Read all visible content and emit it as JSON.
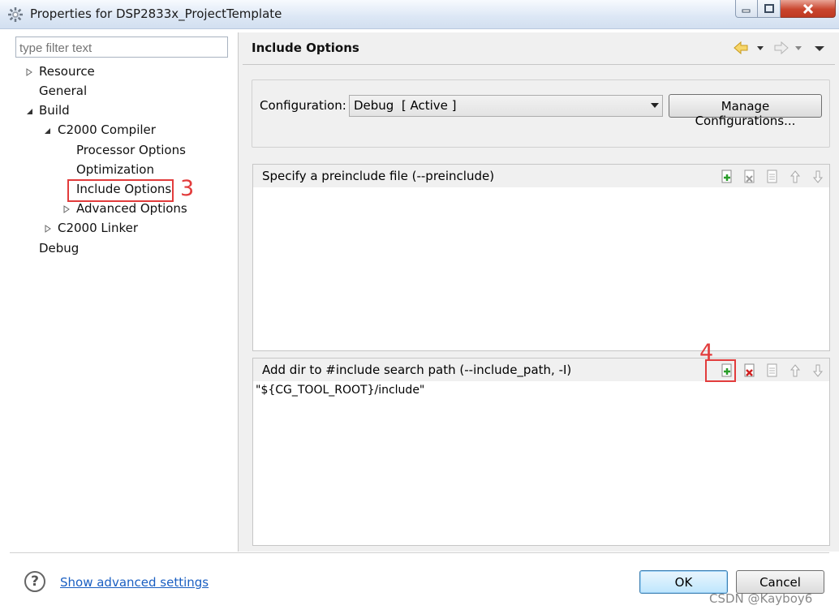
{
  "window": {
    "title": "Properties for DSP2833x_ProjectTemplate",
    "controls": {
      "minimize": "minimize-icon",
      "maximize": "maximize-icon",
      "close": "close-icon"
    }
  },
  "sidebar": {
    "filter_placeholder": "type filter text",
    "tree": [
      {
        "label": "Resource"
      },
      {
        "label": "General"
      },
      {
        "label": "Build"
      },
      {
        "label": "C2000 Compiler"
      },
      {
        "label": "Processor Options"
      },
      {
        "label": "Optimization"
      },
      {
        "label": "Include Options"
      },
      {
        "label": "Advanced Options"
      },
      {
        "label": "C2000 Linker"
      },
      {
        "label": "Debug"
      }
    ],
    "annotation": "3"
  },
  "main": {
    "page_title": "Include Options",
    "configuration": {
      "label": "Configuration:",
      "value": "Debug  [ Active ]",
      "manage_button": "Manage Configurations..."
    },
    "preinclude": {
      "title": "Specify a preinclude file (--preinclude)",
      "items": []
    },
    "include_path": {
      "title": "Add dir to #include search path (--include_path, -I)",
      "items": [
        "\"${CG_TOOL_ROOT}/include\""
      ],
      "annotation": "4"
    }
  },
  "footer": {
    "advanced_link": "Show advanced settings",
    "ok": "OK",
    "cancel": "Cancel",
    "watermark": "CSDN @Kayboy6"
  },
  "colors": {
    "annotation_red": "#e23c3c",
    "link_blue": "#1a5fc2",
    "accent_blue": "#3c7fb1"
  }
}
